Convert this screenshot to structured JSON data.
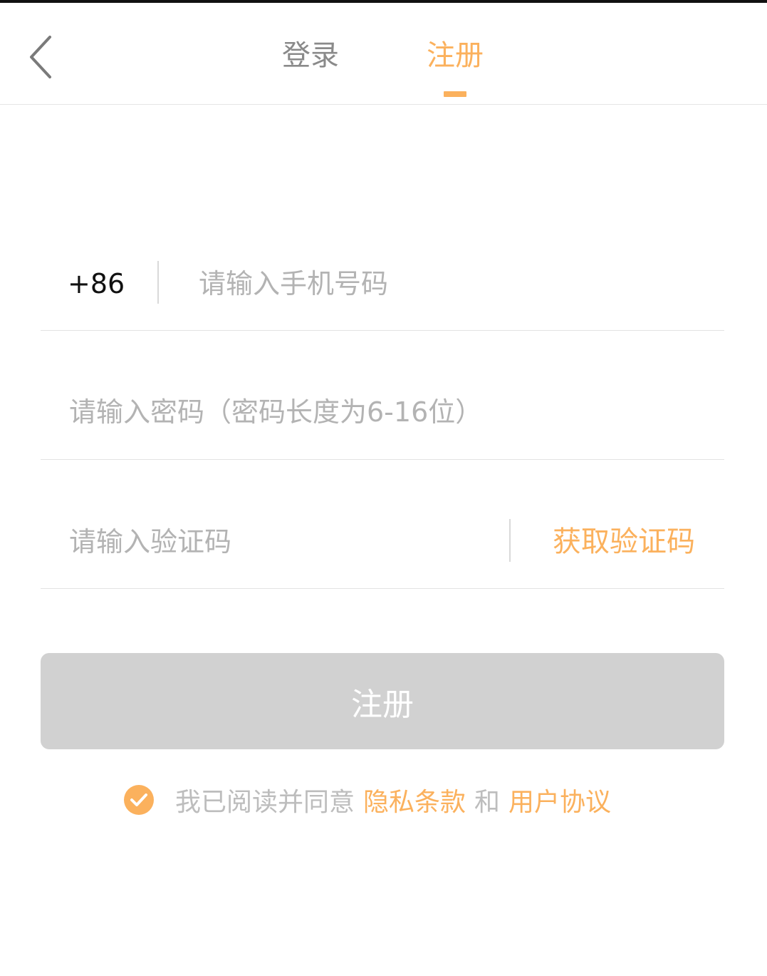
{
  "colors": {
    "accent": "#fbb15d",
    "tab_inactive": "#8a8a8a",
    "placeholder": "#b3b3b3",
    "button_disabled": "#d1d1d1"
  },
  "header": {
    "back_icon": "chevron-left-icon",
    "tabs": [
      {
        "label": "登录",
        "active": false
      },
      {
        "label": "注册",
        "active": true
      }
    ]
  },
  "form": {
    "phone": {
      "country_code": "+86",
      "placeholder": "请输入手机号码",
      "value": ""
    },
    "password": {
      "placeholder": "请输入密码（密码长度为6-16位）",
      "value": ""
    },
    "code": {
      "placeholder": "请输入验证码",
      "value": "",
      "get_code_label": "获取验证码"
    }
  },
  "register_button": {
    "label": "注册",
    "enabled": false
  },
  "agreement": {
    "check_icon": "check-circle-icon",
    "checked": true,
    "prefix": "我已阅读并同意",
    "privacy_link": "隐私条款",
    "joiner": "和",
    "terms_link": "用户协议"
  }
}
